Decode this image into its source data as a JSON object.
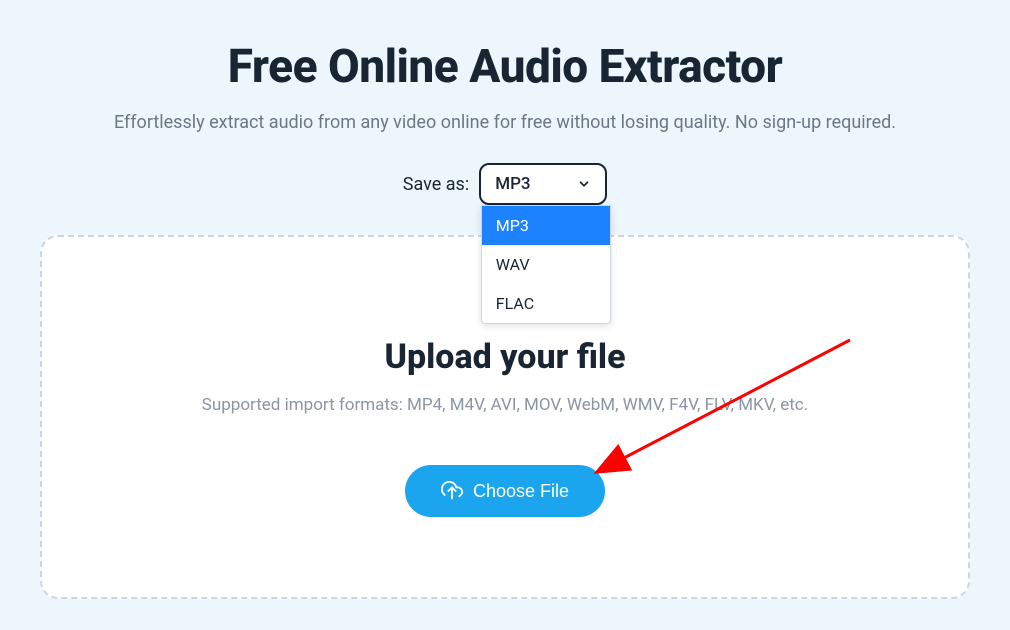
{
  "header": {
    "title": "Free Online Audio Extractor",
    "subtitle": "Effortlessly extract audio from any video online for free without losing quality. No sign-up required."
  },
  "save_as": {
    "label": "Save as:",
    "selected": "MP3",
    "options": [
      "MP3",
      "WAV",
      "FLAC"
    ]
  },
  "upload": {
    "title": "Upload your file",
    "subtitle": "Supported import formats: MP4, M4V, AVI, MOV, WebM, WMV, F4V, FLV, MKV, etc.",
    "button_label": "Choose File"
  },
  "colors": {
    "accent": "#1aa5ee",
    "dropdown_selected": "#1c82ff",
    "annotation": "#ff0000"
  }
}
